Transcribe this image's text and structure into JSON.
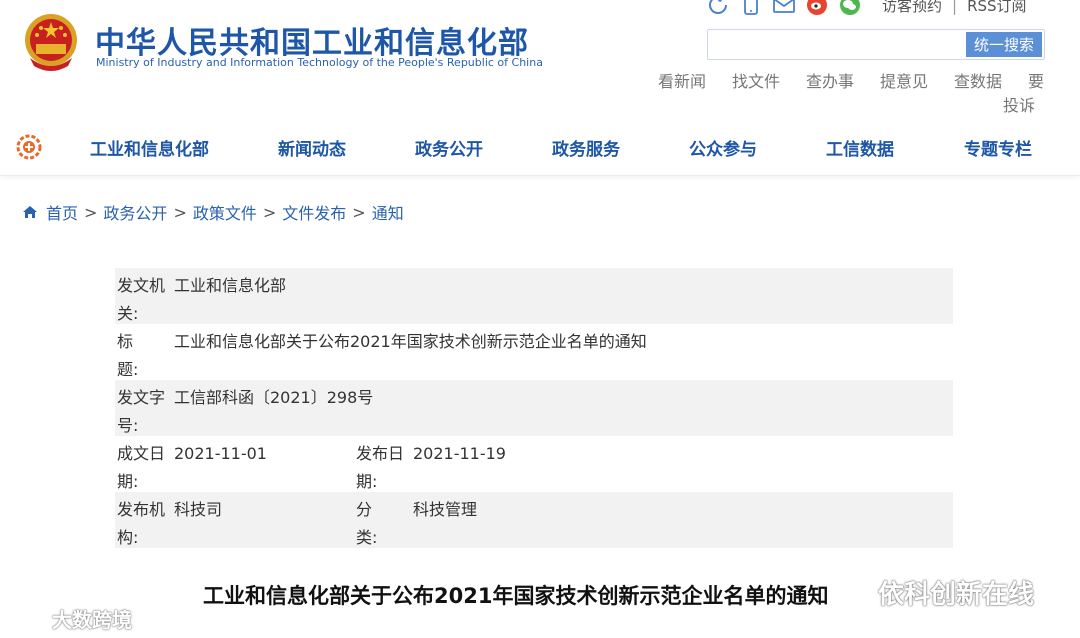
{
  "header": {
    "title": "中华人民共和国工业和信息化部",
    "subtitle": "Ministry of Industry and Information Technology of the People's Republic of China",
    "emblem": "national-emblem"
  },
  "top_bar": {
    "icons": [
      "accessibility-icon",
      "mobile-icon",
      "mail-icon",
      "weibo-icon",
      "wechat-icon"
    ],
    "links": [
      "访客预约",
      "RSS订阅"
    ]
  },
  "search": {
    "placeholder": "",
    "button_label": "统一搜索"
  },
  "quick_links": [
    "看新闻",
    "找文件",
    "查办事",
    "提意见",
    "查数据",
    "要",
    "投诉"
  ],
  "nav": {
    "items": [
      "工业和信息化部",
      "新闻动态",
      "政务公开",
      "政务服务",
      "公众参与",
      "工信数据",
      "专题专栏"
    ]
  },
  "breadcrumb": [
    "首页",
    "政务公开",
    "政策文件",
    "文件发布",
    "通知"
  ],
  "info": {
    "issuer_label": "发文机关:",
    "issuer_value": "工业和信息化部",
    "title_label": "标　　题:",
    "title_value": "工业和信息化部关于公布2021年国家技术创新示范企业名单的通知",
    "docno_label": "发文字号:",
    "docno_value": "工信部科函〔2021〕298号",
    "written_label": "成文日期:",
    "written_value": "2021-11-01",
    "published_label": "发布日期:",
    "published_value": "2021-11-19",
    "org_label": "发布机构:",
    "org_value": "科技司",
    "category_label": "分　　类:",
    "category_value": "科技管理"
  },
  "document_title": "工业和信息化部关于公布2021年国家技术创新示范企业名单的通知",
  "watermarks": {
    "left": "大数跨境",
    "right": "依科创新在线"
  },
  "colors": {
    "brand_blue": "#1f57a8",
    "search_button": "#5b8fd6",
    "row_shade": "#f2f2f2"
  }
}
